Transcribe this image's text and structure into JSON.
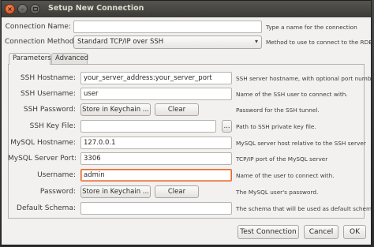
{
  "window": {
    "title": "Setup New Connection"
  },
  "top": {
    "connection_name": {
      "label": "Connection Name:",
      "value": "",
      "hint": "Type a name for the connection"
    },
    "connection_method": {
      "label": "Connection Method:",
      "value": "Standard TCP/IP over SSH",
      "hint": "Method to use to connect to the RDBMS"
    }
  },
  "tabs": [
    {
      "label": "Parameters",
      "active": true
    },
    {
      "label": "Advanced",
      "active": false
    }
  ],
  "params": {
    "ssh_hostname": {
      "label": "SSH Hostname:",
      "value": "your_server_address:your_server_port",
      "hint": "SSH server hostname, with optional port number"
    },
    "ssh_username": {
      "label": "SSH Username:",
      "value": "user",
      "hint": "Name of the SSH user to connect with."
    },
    "ssh_password": {
      "label": "SSH Password:",
      "store": "Store in Keychain ...",
      "clear": "Clear",
      "hint": "Password for the SSH tunnel."
    },
    "ssh_key_file": {
      "label": "SSH Key File:",
      "value": "",
      "browse": "...",
      "hint": "Path to SSH private key file."
    },
    "mysql_hostname": {
      "label": "MySQL Hostname:",
      "value": "127.0.0.1",
      "hint": "MySQL server host relative to the SSH server"
    },
    "mysql_port": {
      "label": "MySQL Server Port:",
      "value": "3306",
      "hint": "TCP/IP port of the MySQL server"
    },
    "username": {
      "label": "Username:",
      "value": "admin",
      "hint": "Name of the user to connect with."
    },
    "password": {
      "label": "Password:",
      "store": "Store in Keychain ...",
      "clear": "Clear",
      "hint": "The MySQL user's password."
    },
    "default_schema": {
      "label": "Default Schema:",
      "value": "",
      "hint": "The schema that will be used as default schema"
    }
  },
  "footer": {
    "test": "Test Connection",
    "cancel": "Cancel",
    "ok": "OK"
  },
  "colors": {
    "titlebar": "#3c3b37",
    "focus": "#e6692e",
    "dialog_bg": "#f2f1f0"
  }
}
